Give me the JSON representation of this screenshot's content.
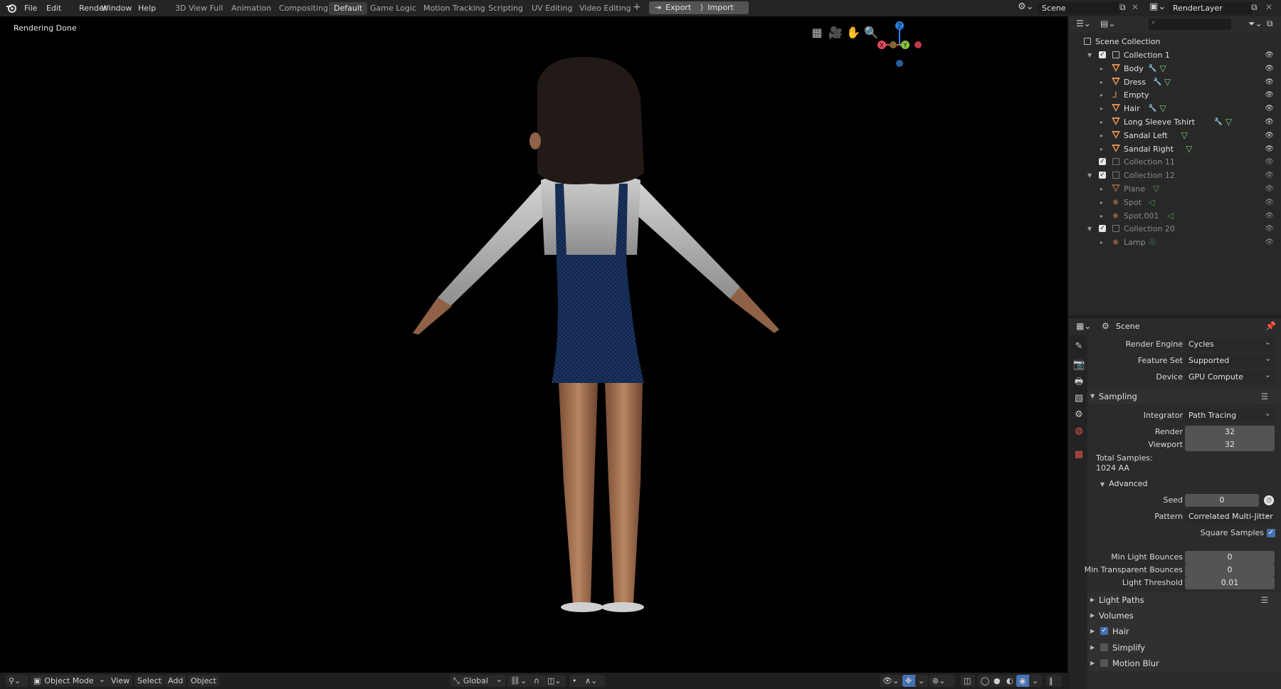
{
  "menu": [
    "File",
    "Edit",
    "Render",
    "Window",
    "Help"
  ],
  "workspaces": [
    {
      "label": "3D View Full",
      "active": false
    },
    {
      "label": "Animation",
      "active": false
    },
    {
      "label": "Compositing",
      "active": false
    },
    {
      "label": "Default",
      "active": true
    },
    {
      "label": "Game Logic",
      "active": false
    },
    {
      "label": "Motion Tracking",
      "active": false
    },
    {
      "label": "Scripting",
      "active": false
    },
    {
      "label": "UV Editing",
      "active": false
    },
    {
      "label": "Video Editing",
      "active": false
    }
  ],
  "add_workspace": "+",
  "export_label": "Export",
  "import_label": "Import",
  "scene_name": "Scene",
  "render_layer": "RenderLayer",
  "viewport": {
    "status": "Rendering Done",
    "gizmo": {
      "z": "Z",
      "y": "Y",
      "x": "X"
    }
  },
  "viewport_header": {
    "mode": "Object Mode",
    "menus": [
      "View",
      "Select",
      "Add",
      "Object"
    ],
    "orientation": "Global"
  },
  "outliner": {
    "root": "Scene Collection",
    "rows": [
      {
        "name": "Collection 1",
        "type": "collection",
        "indent": 0,
        "expand": "open",
        "dim": false,
        "mod": false,
        "data": false
      },
      {
        "name": "Body",
        "type": "mesh",
        "indent": 1,
        "dim": false,
        "mod": true,
        "data": true
      },
      {
        "name": "Dress",
        "type": "mesh",
        "indent": 1,
        "dim": false,
        "mod": true,
        "data": true
      },
      {
        "name": "Empty",
        "type": "empty",
        "indent": 1,
        "dim": false,
        "mod": false,
        "data": false
      },
      {
        "name": "Hair",
        "type": "mesh",
        "indent": 1,
        "dim": false,
        "mod": true,
        "data": true
      },
      {
        "name": "Long Sleeve Tshirt",
        "type": "mesh",
        "indent": 1,
        "dim": false,
        "mod": true,
        "data": true
      },
      {
        "name": "Sandal Left",
        "type": "mesh",
        "indent": 1,
        "dim": false,
        "mod": false,
        "data": true
      },
      {
        "name": "Sandal Right",
        "type": "mesh",
        "indent": 1,
        "dim": false,
        "mod": false,
        "data": true
      },
      {
        "name": "Collection 11",
        "type": "collection",
        "indent": 0,
        "expand": "none",
        "dim": true,
        "mod": false,
        "data": false
      },
      {
        "name": "Collection 12",
        "type": "collection",
        "indent": 0,
        "expand": "open",
        "dim": true,
        "mod": false,
        "data": false
      },
      {
        "name": "Plane",
        "type": "mesh",
        "indent": 1,
        "dim": true,
        "mod": false,
        "data": true
      },
      {
        "name": "Spot",
        "type": "light",
        "indent": 1,
        "dim": true,
        "mod": false,
        "data": true
      },
      {
        "name": "Spot.001",
        "type": "light",
        "indent": 1,
        "dim": true,
        "mod": false,
        "data": true
      },
      {
        "name": "Collection 20",
        "type": "collection",
        "indent": 0,
        "expand": "open",
        "dim": true,
        "mod": false,
        "data": false
      },
      {
        "name": "Lamp",
        "type": "light",
        "indent": 1,
        "dim": true,
        "mod": false,
        "data": true
      }
    ]
  },
  "properties": {
    "context": "Scene",
    "render_engine": {
      "label": "Render Engine",
      "value": "Cycles"
    },
    "feature_set": {
      "label": "Feature Set",
      "value": "Supported"
    },
    "device": {
      "label": "Device",
      "value": "GPU Compute"
    },
    "sampling": {
      "title": "Sampling",
      "integrator": {
        "label": "Integrator",
        "value": "Path Tracing"
      },
      "render": {
        "label": "Render",
        "value": "32"
      },
      "viewport": {
        "label": "Viewport",
        "value": "32"
      },
      "total_samples_label": "Total Samples:",
      "total_samples_value": "1024 AA",
      "advanced": {
        "title": "Advanced",
        "seed": {
          "label": "Seed",
          "value": "0"
        },
        "pattern": {
          "label": "Pattern",
          "value": "Correlated Multi-Jitter"
        },
        "square_samples": {
          "label": "Square Samples",
          "checked": true
        },
        "min_light_bounces": {
          "label": "Min Light Bounces",
          "value": "0"
        },
        "min_transparent_bounces": {
          "label": "Min Transparent Bounces",
          "value": "0"
        },
        "light_threshold": {
          "label": "Light Threshold",
          "value": "0.01"
        }
      }
    },
    "panels": [
      {
        "label": "Light Paths",
        "checkbox": false,
        "checked": false,
        "list_icon": true
      },
      {
        "label": "Volumes",
        "checkbox": false,
        "checked": false,
        "list_icon": false
      },
      {
        "label": "Hair",
        "checkbox": true,
        "checked": true,
        "list_icon": false
      },
      {
        "label": "Simplify",
        "checkbox": true,
        "checked": false,
        "list_icon": false
      },
      {
        "label": "Motion Blur",
        "checkbox": true,
        "checked": false,
        "list_icon": false
      }
    ]
  },
  "colors": {
    "accent_blue": "#4772b3",
    "axis_x": "#e84a5f",
    "axis_y": "#8cc43c",
    "axis_z": "#2a80e8",
    "mesh_orange": "#e09050",
    "data_green": "#7bd37b",
    "modifier_blue": "#7fa9ff"
  }
}
